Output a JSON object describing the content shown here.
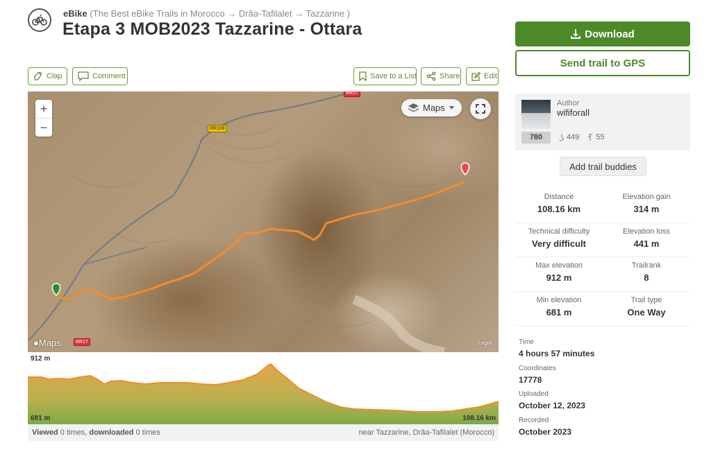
{
  "breadcrumb": {
    "activity": "eBike",
    "path": "(The Best eBike Trails in Morocco → Drâa-Tafilalet → Tazzarine )"
  },
  "title": "Etapa 3 MOB2023 Tazzarine - Ottara",
  "actions": {
    "clap": "Clap",
    "comment": "Comment",
    "save": "Save to a List",
    "share": "Share",
    "edit": "Edit"
  },
  "map": {
    "zoom_in": "+",
    "zoom_out": "−",
    "layer_button": "Maps",
    "road_labels": [
      "RR108",
      "RR17",
      "RR17"
    ],
    "logo": "Maps",
    "legal": "Legal",
    "route_color": "#f28c2e",
    "start_marker_color": "#2e8b2e",
    "end_marker_color": "#e84b4b"
  },
  "elevation_profile": {
    "max_label": "912 m",
    "min_label": "681 m",
    "distance_label": "108.16 km",
    "fill_color": "#8fb24a",
    "line_color": "#f28c2e"
  },
  "footer": {
    "viewed_label": "Viewed",
    "viewed_value": "0 times,",
    "downloaded_label": "downloaded",
    "downloaded_value": "0 times",
    "location": "near Tazzarine, Drâa-Tafilalet (Morocco)"
  },
  "primary": {
    "download": "Download",
    "send_gps": "Send trail to GPS"
  },
  "author": {
    "label": "Author",
    "name": "wififorall",
    "rank": "780",
    "followers": "449",
    "trails": "55"
  },
  "add_buddies": "Add trail buddies",
  "stats": [
    [
      {
        "label": "Distance",
        "value": "108.16 km"
      },
      {
        "label": "Elevation gain",
        "value": "314 m"
      }
    ],
    [
      {
        "label": "Technical difficulty",
        "value": "Very difficult"
      },
      {
        "label": "Elevation loss",
        "value": "441 m"
      }
    ],
    [
      {
        "label": "Max elevation",
        "value": "912 m"
      },
      {
        "label": "Trailrank",
        "value": "8"
      }
    ],
    [
      {
        "label": "Min elevation",
        "value": "681 m"
      },
      {
        "label": "Trail type",
        "value": "One Way"
      }
    ]
  ],
  "meta": [
    {
      "label": "Time",
      "value": "4 hours 57 minutes"
    },
    {
      "label": "Coordinates",
      "value": "17778"
    },
    {
      "label": "Uploaded",
      "value": "October 12, 2023"
    },
    {
      "label": "Recorded",
      "value": "October 2023"
    }
  ],
  "colors": {
    "brand_green": "#4b8a27",
    "outline_green": "#6a9c3b"
  }
}
